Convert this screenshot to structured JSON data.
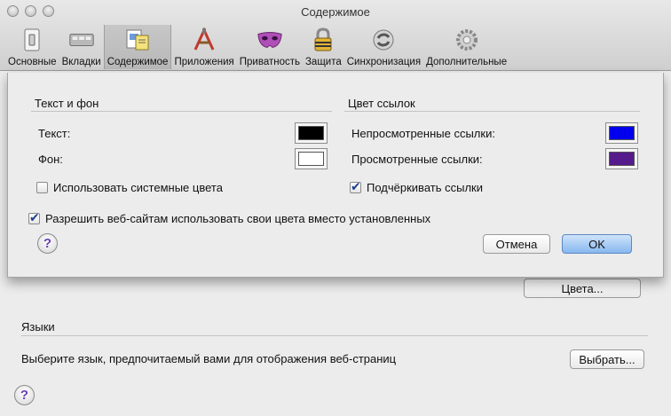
{
  "window": {
    "title": "Содержимое"
  },
  "toolbar": {
    "items": [
      {
        "label": "Основные",
        "icon": "switch-icon"
      },
      {
        "label": "Вкладки",
        "icon": "tabs-icon"
      },
      {
        "label": "Содержимое",
        "icon": "content-icon",
        "selected": true
      },
      {
        "label": "Приложения",
        "icon": "applications-icon"
      },
      {
        "label": "Приватность",
        "icon": "mask-icon"
      },
      {
        "label": "Защита",
        "icon": "lock-icon"
      },
      {
        "label": "Синхронизация",
        "icon": "sync-icon"
      },
      {
        "label": "Дополнительные",
        "icon": "gear-icon"
      }
    ]
  },
  "background": {
    "colors_button": "Цвета...",
    "languages_head": "Языки",
    "languages_text": "Выберите язык, предпочитаемый вами для отображения веб-страниц",
    "choose_button": "Выбрать..."
  },
  "sheet": {
    "text_bg_head": "Текст и фон",
    "text_label": "Текст:",
    "bg_label": "Фон:",
    "use_system_colors": "Использовать системные цвета",
    "link_colors_head": "Цвет ссылок",
    "unvisited_label": "Непросмотренные ссылки:",
    "visited_label": "Просмотренные ссылки:",
    "underline_links": "Подчёркивать ссылки",
    "allow_sites_colors": "Разрешить веб-сайтам использовать свои цвета вместо установленных",
    "cancel_button": "Отмена",
    "ok_button": "OK",
    "colors": {
      "text": "#000000",
      "background": "#ffffff",
      "unvisited": "#0000ee",
      "visited": "#551a8b"
    },
    "checks": {
      "use_system_colors": false,
      "underline_links": true,
      "allow_sites_colors": true
    }
  }
}
